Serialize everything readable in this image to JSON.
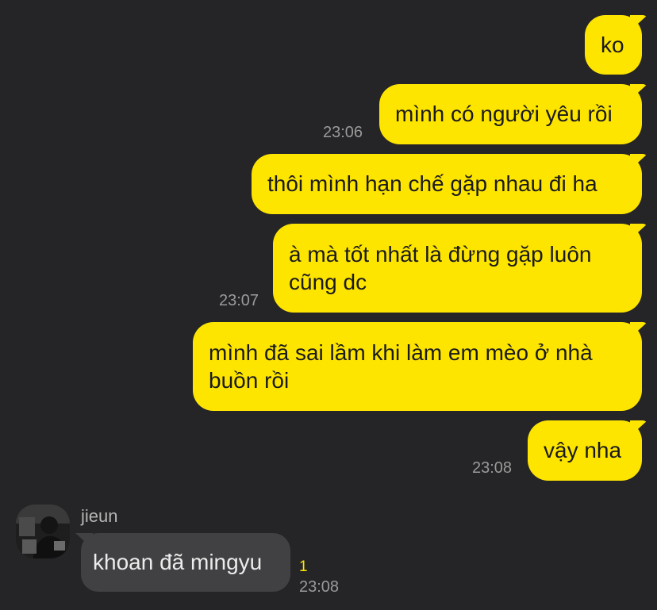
{
  "messages_out": [
    {
      "text": "ko",
      "time": ""
    },
    {
      "text": "mình có người yêu rồi",
      "time": "23:06"
    },
    {
      "text": "thôi mình hạn chế gặp nhau đi ha",
      "time": ""
    },
    {
      "text_line1": "à mà tốt nhất là đừng gặp luôn",
      "text_line2": "cũng dc",
      "time": "23:07"
    },
    {
      "text_line1": "mình đã sai lầm khi làm em mèo ở nhà",
      "text_line2": "buồn rồi",
      "time": ""
    },
    {
      "text": "vậy nha",
      "time": "23:08"
    }
  ],
  "incoming": {
    "sender_name": "jieun",
    "avatar_icon": "profile-photo-avatar",
    "text": "khoan đã mingyu",
    "unread_count": "1",
    "time": "23:08"
  },
  "colors": {
    "background": "#252527",
    "outgoing_bubble": "#fee500",
    "incoming_bubble": "#414143",
    "timestamp": "#9a9a9a",
    "unread": "#fee500"
  }
}
